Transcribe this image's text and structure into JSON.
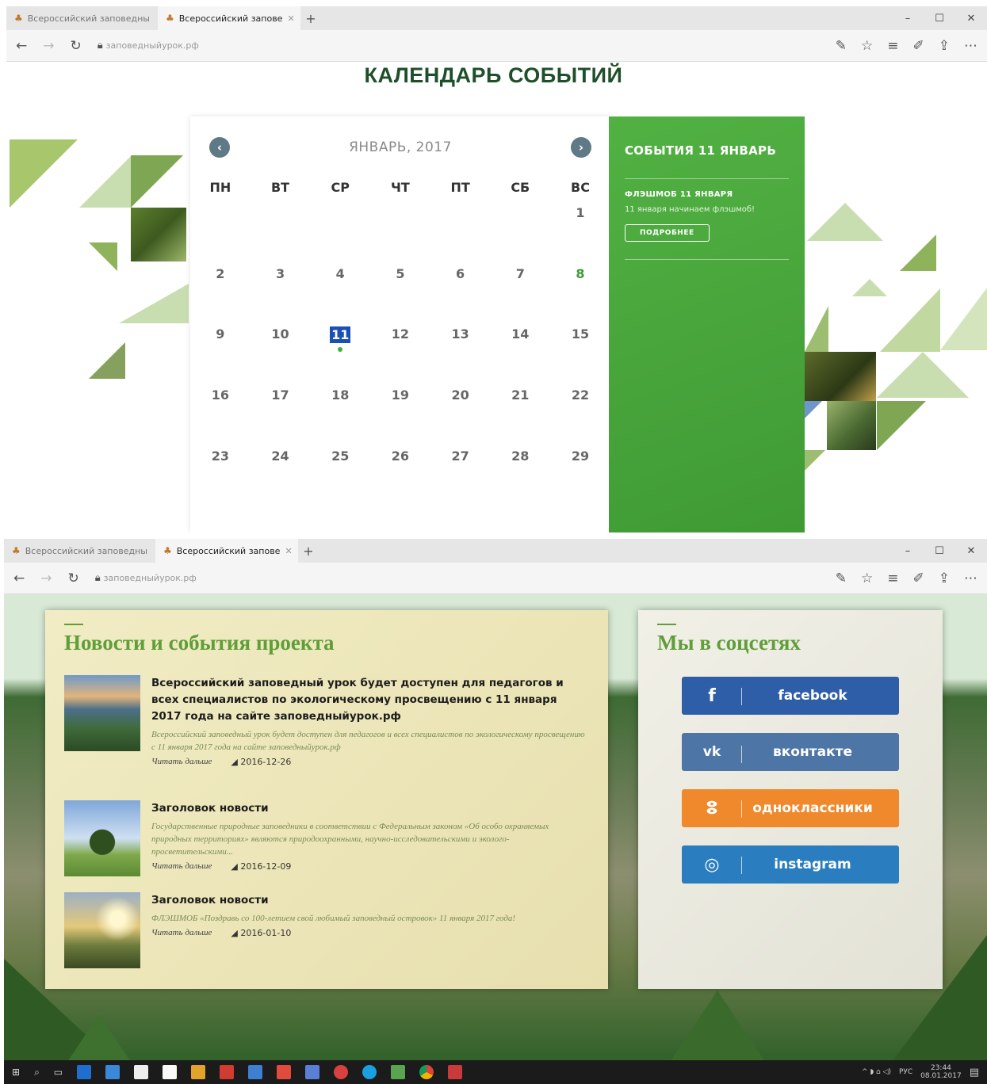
{
  "browser": {
    "tab1": "Всероссийский заповедны",
    "tab2": "Всероссийский заповe",
    "url": "заповедныйурок.рф",
    "window_controls": [
      "–",
      "☐",
      "✕"
    ]
  },
  "calendar_page": {
    "title": "КАЛЕНДАРЬ СОБЫТИЙ",
    "month": "ЯНВАРЬ, 2017",
    "prev": "‹",
    "next": "›",
    "weekdays": [
      "ПН",
      "ВТ",
      "СР",
      "ЧТ",
      "ПТ",
      "СБ",
      "ВС"
    ],
    "days": [
      "",
      "",
      "",
      "",
      "",
      "",
      "1",
      "2",
      "3",
      "4",
      "5",
      "6",
      "7",
      "8",
      "9",
      "10",
      "11",
      "12",
      "13",
      "14",
      "15",
      "16",
      "17",
      "18",
      "19",
      "20",
      "21",
      "22",
      "23",
      "24",
      "25",
      "26",
      "27",
      "28",
      "29"
    ],
    "selected_day": "11",
    "highlight_day": "8",
    "events_header": "СОБЫТИЯ 11 ЯНВАРЬ",
    "event_title": "ФЛЭШМОБ 11 ЯНВАРЯ",
    "event_text": "11 января начинаем флэшмоб!",
    "event_button": "ПОДРОБНЕЕ"
  },
  "news_page": {
    "news_title": "Новости и события проекта",
    "items": [
      {
        "title": "Всероссийский заповедный урок будет доступен для педагогов и всех специалистов по экологическому просвещению с 11 января 2017 года на сайте заповедныйурок.рф",
        "text": "Всероссийский заповедный урок будет доступен для педагогов и всех специалистов по экологическому просвещению с 11 января 2017 года на сайте заповедныйурок.рф",
        "read": "Читать дальше",
        "date": "2016-12-26"
      },
      {
        "title": "Заголовок новости",
        "text": "Государственные природные заповедники в соответствии с Федеральным законом «Об особо охраняемых природных территориях» являются природоохранными, научно-исследовательскими и эколого-просветительскими...",
        "read": "Читать дальше",
        "date": "2016-12-09"
      },
      {
        "title": "Заголовок новости",
        "text": "ФЛЭШМОБ «Поздравь со 100-летием свой любимый заповедный островок» 11 января 2017 года!",
        "read": "Читать дальше",
        "date": "2016-01-10"
      }
    ],
    "social_title": "Мы в соцсетях",
    "social": [
      {
        "icon": "f",
        "label": "facebook",
        "color": "#2f5ea8"
      },
      {
        "icon": "vk",
        "label": "вконтакте",
        "color": "#4d76a7"
      },
      {
        "icon": "ok",
        "label": "одноклассники",
        "color": "#f0892b"
      },
      {
        "icon": "ig",
        "label": "instagram",
        "color": "#2a7ec0"
      }
    ]
  },
  "taskbar": {
    "lang": "РУС",
    "time": "23:44",
    "date": "08.01.2017"
  }
}
